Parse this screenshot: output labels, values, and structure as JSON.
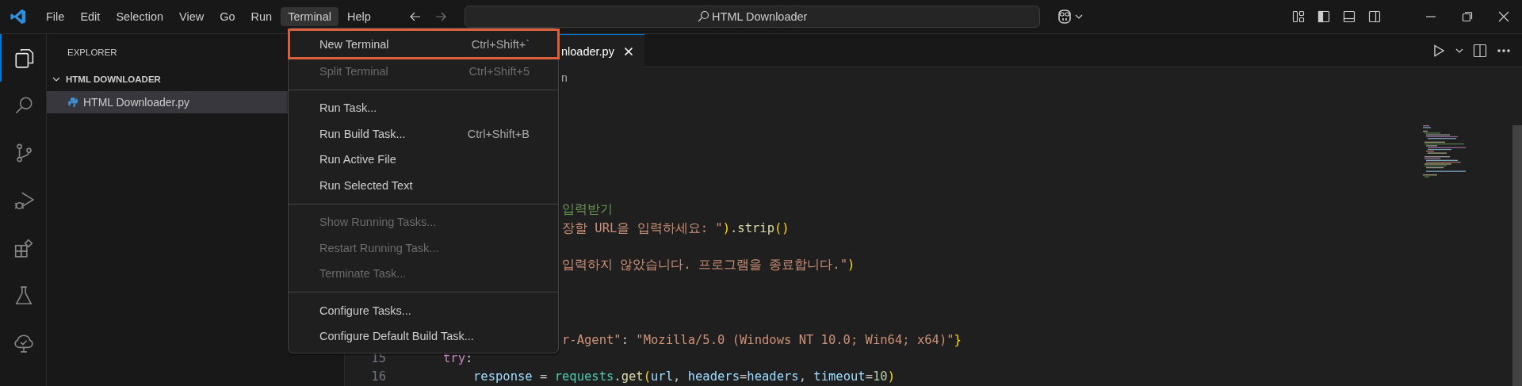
{
  "menubar": [
    {
      "label": "File",
      "selected": false
    },
    {
      "label": "Edit",
      "selected": false
    },
    {
      "label": "Selection",
      "selected": false
    },
    {
      "label": "View",
      "selected": false
    },
    {
      "label": "Go",
      "selected": false
    },
    {
      "label": "Run",
      "selected": false
    },
    {
      "label": "Terminal",
      "selected": true
    },
    {
      "label": "Help",
      "selected": false
    }
  ],
  "command_center": {
    "text": "HTML Downloader"
  },
  "activity_bar": [
    {
      "kind": "files",
      "selected": true
    },
    {
      "kind": "search",
      "selected": false
    },
    {
      "kind": "source-control",
      "selected": false
    },
    {
      "kind": "run-debug",
      "selected": false
    },
    {
      "kind": "extensions",
      "selected": false
    },
    {
      "kind": "testing",
      "selected": false
    },
    {
      "kind": "tree-check",
      "selected": false
    }
  ],
  "sidebar": {
    "title": "EXPLORER",
    "folder": {
      "label": "HTML DOWNLOADER",
      "expanded": true,
      "children": [
        {
          "label": "HTML Downloader.py",
          "selected": true
        }
      ]
    }
  },
  "tabs": [
    {
      "label": "nloader.py",
      "selected": true
    }
  ],
  "breadcrumb": "n",
  "editor": {
    "lines": [
      {
        "kind": "blank"
      },
      {
        "kind": "blank"
      },
      {
        "kind": "blank"
      },
      {
        "kind": "blank"
      },
      {
        "kind": "blank"
      },
      {
        "kind": "blank"
      },
      {
        "kind": "partial",
        "tokens": [
          {
            "text": "입력받기",
            "kind": "comment"
          }
        ]
      },
      {
        "kind": "partial",
        "tokens": [
          {
            "text": "장할 URL을 입력하세요: \"",
            "kind": "string"
          },
          {
            "text": ")",
            "kind": "paren"
          },
          {
            "text": ".",
            "kind": "plain"
          },
          {
            "text": "strip",
            "kind": "func"
          },
          {
            "text": "()",
            "kind": "paren"
          }
        ]
      },
      {
        "kind": "blank"
      },
      {
        "kind": "partial",
        "tokens": [
          {
            "text": "입력하지 않았습니다. 프로그램을 종료합니다.\"",
            "kind": "string"
          },
          {
            "text": ")",
            "kind": "paren"
          }
        ]
      },
      {
        "kind": "blank"
      },
      {
        "kind": "blank"
      },
      {
        "kind": "blank"
      },
      {
        "kind": "partial",
        "tokens": [
          {
            "text": "r-Agent\"",
            "kind": "string"
          },
          {
            "text": ": ",
            "kind": "plain"
          },
          {
            "text": "\"Mozilla/5.0 (Windows NT 10.0; Win64; x64)\"",
            "kind": "string"
          },
          {
            "text": "}",
            "kind": "paren"
          }
        ]
      },
      {
        "kind": "code",
        "number": "15",
        "indented": false,
        "tokens": [
          {
            "text": "try",
            "kind": "keyword"
          },
          {
            "text": ":",
            "kind": "plain"
          }
        ]
      },
      {
        "kind": "code",
        "number": "16",
        "indented": true,
        "tokens": [
          {
            "text": "response",
            "kind": "var"
          },
          {
            "text": " = ",
            "kind": "plain"
          },
          {
            "text": "requests",
            "kind": "module"
          },
          {
            "text": ".",
            "kind": "plain"
          },
          {
            "text": "get",
            "kind": "func"
          },
          {
            "text": "(",
            "kind": "paren"
          },
          {
            "text": "url",
            "kind": "var"
          },
          {
            "text": ", ",
            "kind": "plain"
          },
          {
            "text": "headers",
            "kind": "var"
          },
          {
            "text": "=",
            "kind": "plain"
          },
          {
            "text": "headers",
            "kind": "var"
          },
          {
            "text": ", ",
            "kind": "plain"
          },
          {
            "text": "timeout",
            "kind": "var"
          },
          {
            "text": "=",
            "kind": "plain"
          },
          {
            "text": "10",
            "kind": "number"
          },
          {
            "text": ")",
            "kind": "paren"
          }
        ]
      }
    ]
  },
  "terminal_menu": [
    {
      "kind": "item",
      "label": "New Terminal",
      "shortcut": "Ctrl+Shift+`",
      "disabled": false,
      "highlighted": true
    },
    {
      "kind": "item",
      "label": "Split Terminal",
      "shortcut": "Ctrl+Shift+5",
      "disabled": true,
      "highlighted": false
    },
    {
      "kind": "separator"
    },
    {
      "kind": "item",
      "label": "Run Task...",
      "disabled": false,
      "highlighted": false
    },
    {
      "kind": "item",
      "label": "Run Build Task...",
      "shortcut": "Ctrl+Shift+B",
      "disabled": false,
      "highlighted": false
    },
    {
      "kind": "item",
      "label": "Run Active File",
      "disabled": false,
      "highlighted": false
    },
    {
      "kind": "item",
      "label": "Run Selected Text",
      "disabled": false,
      "highlighted": false
    },
    {
      "kind": "separator"
    },
    {
      "kind": "item",
      "label": "Show Running Tasks...",
      "disabled": true,
      "highlighted": false
    },
    {
      "kind": "item",
      "label": "Restart Running Task...",
      "disabled": true,
      "highlighted": false
    },
    {
      "kind": "item",
      "label": "Terminate Task...",
      "disabled": true,
      "highlighted": false
    },
    {
      "kind": "separator"
    },
    {
      "kind": "item",
      "label": "Configure Tasks...",
      "disabled": false,
      "highlighted": false
    },
    {
      "kind": "item",
      "label": "Configure Default Build Task...",
      "disabled": false,
      "highlighted": false
    }
  ]
}
